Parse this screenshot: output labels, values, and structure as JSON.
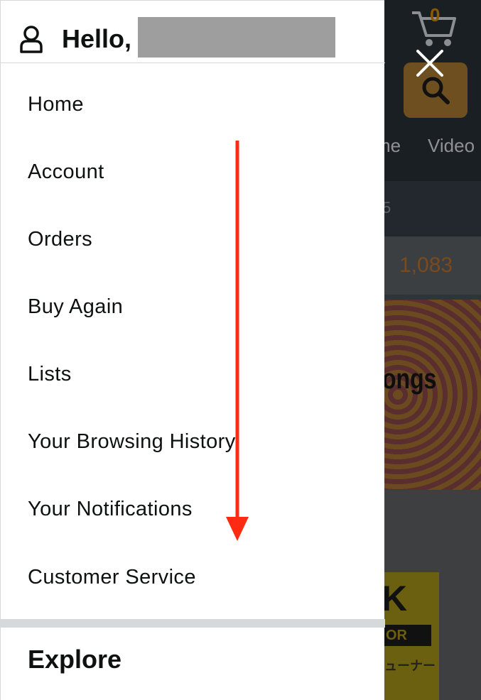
{
  "background": {
    "cart_count": "0",
    "nav_items": [
      "me",
      "Video"
    ],
    "strip_text": "5",
    "count_text": "1,083",
    "banner_text": "ongs",
    "logo_text": "K",
    "logo_bar_text": "OR",
    "logo_jp_text": "ューナー"
  },
  "drawer": {
    "greeting": "Hello,",
    "menu_items": [
      {
        "label": "Home"
      },
      {
        "label": "Account"
      },
      {
        "label": "Orders"
      },
      {
        "label": "Buy Again"
      },
      {
        "label": "Lists"
      },
      {
        "label": "Your Browsing History"
      },
      {
        "label": "Your Notifications"
      },
      {
        "label": "Customer Service"
      }
    ],
    "section_title": "Explore"
  },
  "colors": {
    "drawer_bg": "#ffffff",
    "text": "#0f1111",
    "divider": "#d5d9d9",
    "overlay": "#2f3439",
    "arrow": "#ff2a12",
    "redaction": "#9e9e9e"
  },
  "icons": {
    "user": "user-icon",
    "close": "close-icon",
    "cart": "cart-icon",
    "search": "search-icon",
    "arrow": "scroll-down-arrow-icon"
  }
}
